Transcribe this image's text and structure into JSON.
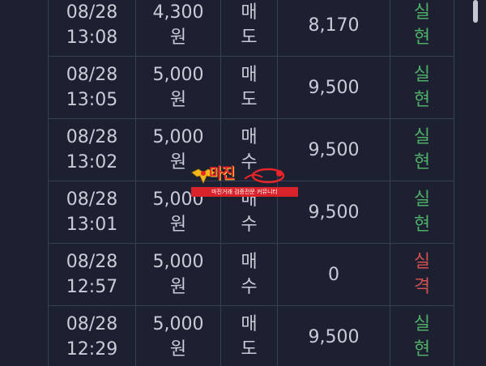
{
  "rows": [
    {
      "date": "08/28",
      "time": "13:08",
      "price": "4,300",
      "unit": "원",
      "side_1": "매",
      "side_2": "도",
      "amount": "8,170",
      "result_1": "실",
      "result_2": "현",
      "result_color": "#4fae68"
    },
    {
      "date": "08/28",
      "time": "13:05",
      "price": "5,000",
      "unit": "원",
      "side_1": "매",
      "side_2": "도",
      "amount": "9,500",
      "result_1": "실",
      "result_2": "현",
      "result_color": "#4fae68"
    },
    {
      "date": "08/28",
      "time": "13:02",
      "price": "5,000",
      "unit": "원",
      "side_1": "매",
      "side_2": "수",
      "amount": "9,500",
      "result_1": "실",
      "result_2": "현",
      "result_color": "#4fae68"
    },
    {
      "date": "08/28",
      "time": "13:01",
      "price": "5,000",
      "unit": "원",
      "side_1": "매",
      "side_2": "수",
      "amount": "9,500",
      "result_1": "실",
      "result_2": "현",
      "result_color": "#4fae68"
    },
    {
      "date": "08/28",
      "time": "12:57",
      "price": "5,000",
      "unit": "원",
      "side_1": "매",
      "side_2": "수",
      "amount": "0",
      "result_1": "실",
      "result_2": "격",
      "result_color": "#d0514f"
    },
    {
      "date": "08/28",
      "time": "12:29",
      "price": "5,000",
      "unit": "원",
      "side_1": "매",
      "side_2": "도",
      "amount": "9,500",
      "result_1": "실",
      "result_2": "현",
      "result_color": "#4fae68"
    }
  ],
  "watermark": {
    "brand": "마진",
    "tagline": "마진거래 검증전문 커뮤니티"
  },
  "colors": {
    "background": "#1c2030",
    "border": "#3a3f50",
    "text": "#c9ccd6",
    "success": "#4fae68",
    "failure": "#d0514f",
    "watermark_red": "#d8232a"
  }
}
